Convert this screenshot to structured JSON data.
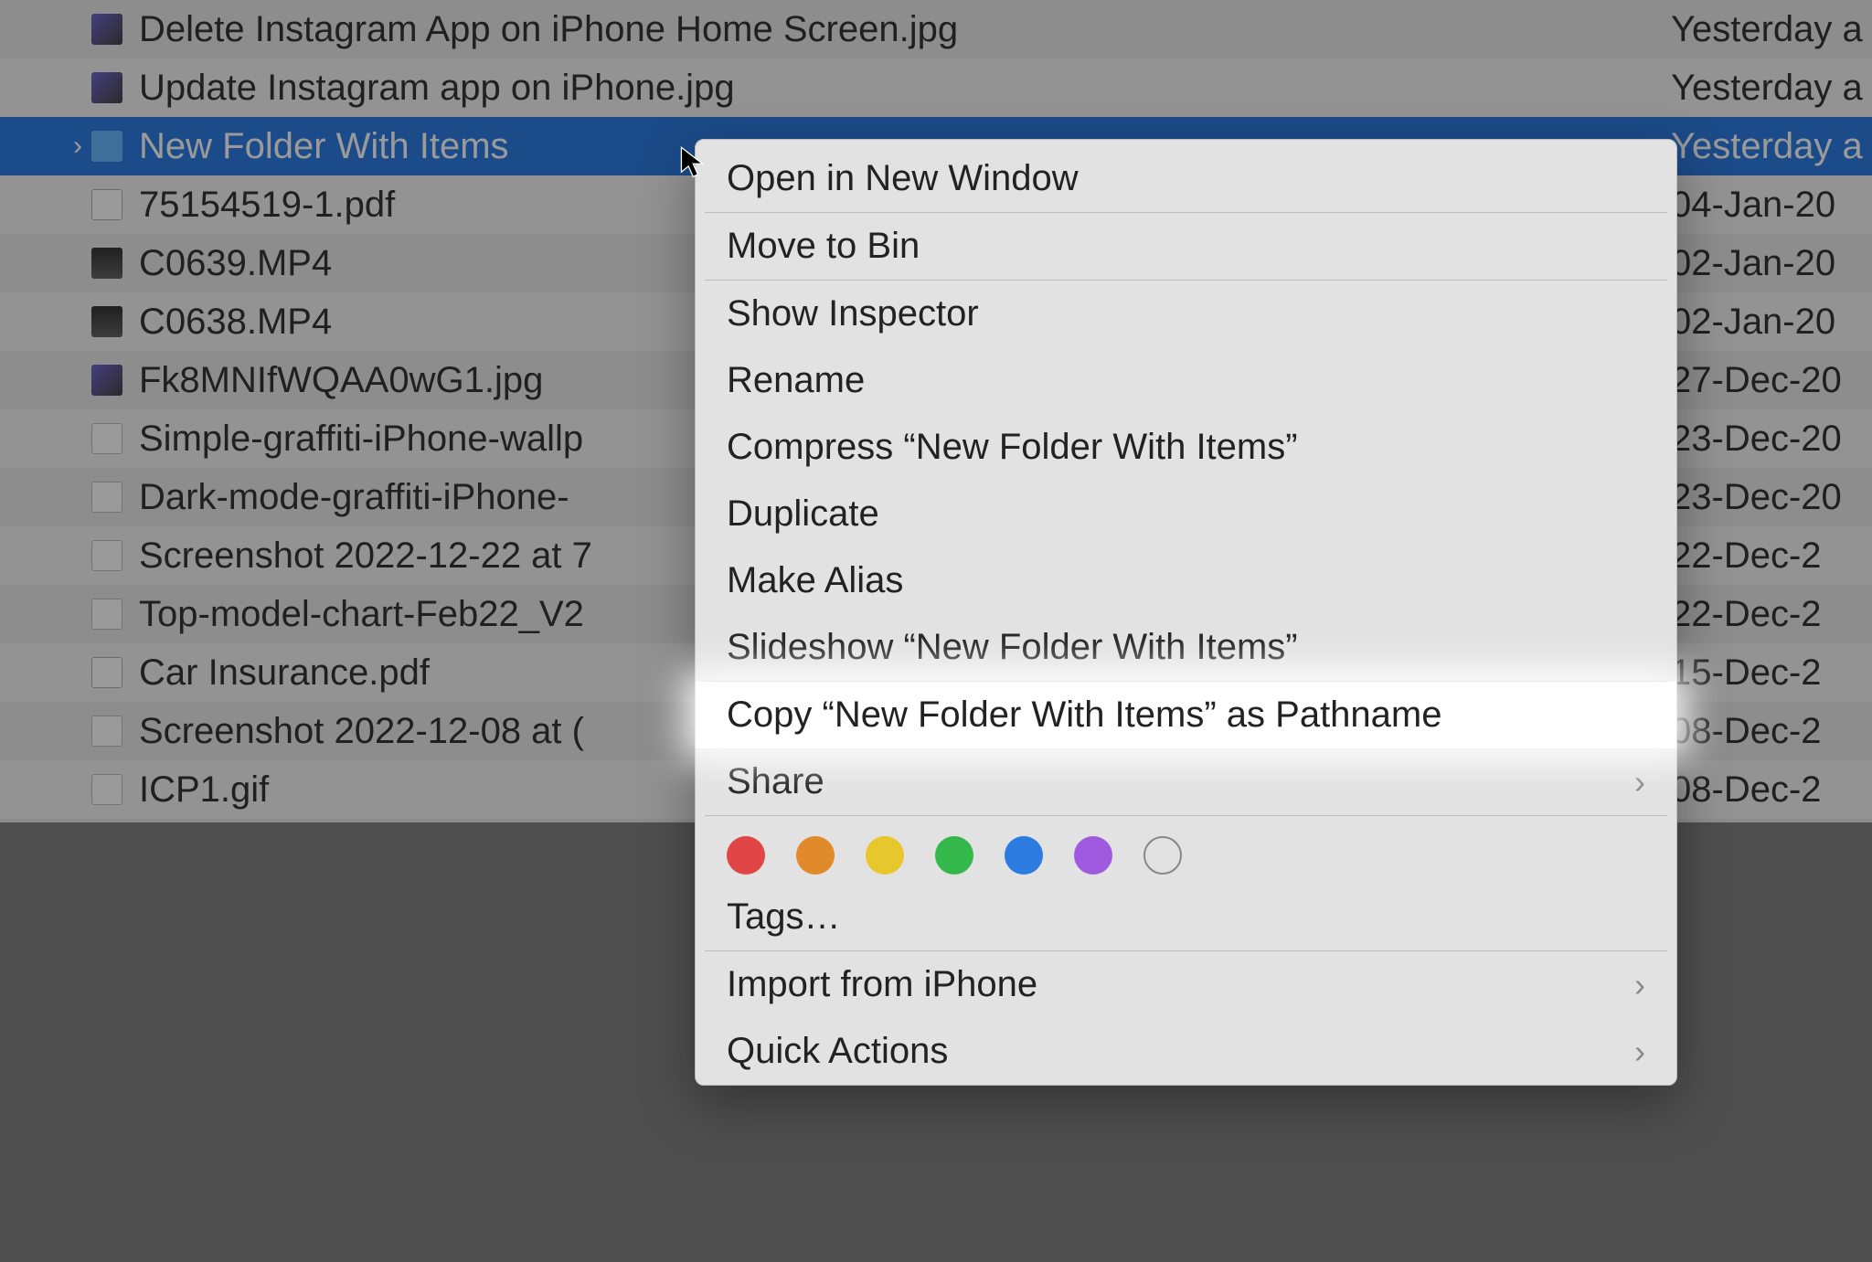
{
  "files": [
    {
      "name": "Delete Instagram App on iPhone Home Screen.jpg",
      "date": "Yesterday a",
      "icon": "img"
    },
    {
      "name": "Update Instagram app on iPhone.jpg",
      "date": "Yesterday a",
      "icon": "img"
    },
    {
      "name": "New Folder With Items",
      "date": "Yesterday a",
      "icon": "folder",
      "selected": true,
      "disclosure": true
    },
    {
      "name": "75154519-1.pdf",
      "date": "04-Jan-20",
      "icon": "pdf"
    },
    {
      "name": "C0639.MP4",
      "date": "02-Jan-20",
      "icon": "video"
    },
    {
      "name": "C0638.MP4",
      "date": "02-Jan-20",
      "icon": "video"
    },
    {
      "name": "Fk8MNIfWQAA0wG1.jpg",
      "date": "27-Dec-20",
      "icon": "img"
    },
    {
      "name": "Simple-graffiti-iPhone-wallp",
      "date": "23-Dec-20",
      "icon": "generic"
    },
    {
      "name": "Dark-mode-graffiti-iPhone-",
      "date": "23-Dec-20",
      "icon": "generic"
    },
    {
      "name": "Screenshot 2022-12-22 at 7",
      "date": "22-Dec-2",
      "icon": "generic"
    },
    {
      "name": "Top-model-chart-Feb22_V2",
      "date": "22-Dec-2",
      "icon": "generic"
    },
    {
      "name": "Car Insurance.pdf",
      "date": "15-Dec-2",
      "icon": "pdf"
    },
    {
      "name": "Screenshot 2022-12-08 at (",
      "date": "08-Dec-2",
      "icon": "generic"
    },
    {
      "name": "ICP1.gif",
      "date": "08-Dec-2",
      "icon": "generic"
    }
  ],
  "menu": {
    "open_new_window": "Open in New Window",
    "move_to_bin": "Move to Bin",
    "show_inspector": "Show Inspector",
    "rename": "Rename",
    "compress": "Compress “New Folder With Items”",
    "duplicate": "Duplicate",
    "make_alias": "Make Alias",
    "slideshow": "Slideshow “New Folder With Items”",
    "copy_pathname": "Copy “New Folder With Items” as Pathname",
    "share": "Share",
    "tags": "Tags…",
    "import_iphone": "Import from iPhone",
    "quick_actions": "Quick Actions"
  },
  "tag_colors": [
    "#e04444",
    "#e08a2c",
    "#e6c82c",
    "#34b84b",
    "#2c7be0",
    "#a05ae0"
  ]
}
